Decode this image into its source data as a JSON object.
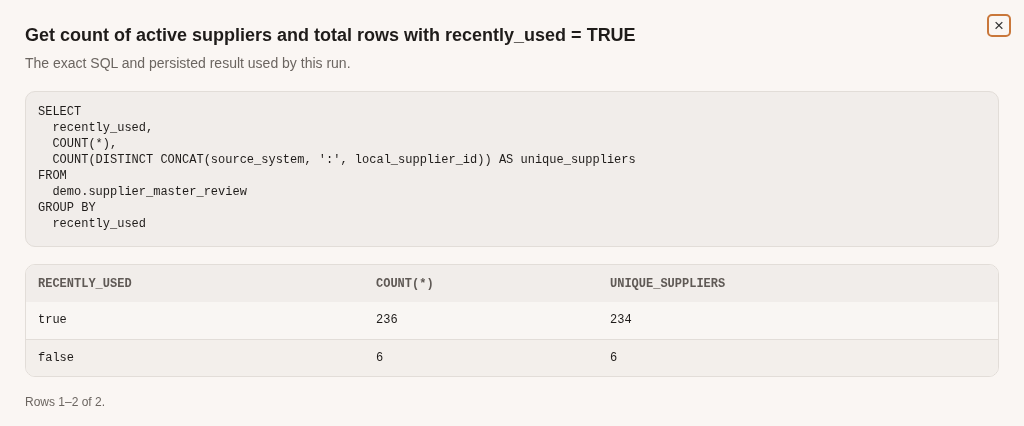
{
  "dialog": {
    "title": "Get count of active suppliers and total rows with recently_used = TRUE",
    "subtitle": "The exact SQL and persisted result used by this run.",
    "close_label": "×"
  },
  "sql": "SELECT\n  recently_used,\n  COUNT(*),\n  COUNT(DISTINCT CONCAT(source_system, ':', local_supplier_id)) AS unique_suppliers\nFROM\n  demo.supplier_master_review\nGROUP BY\n  recently_used",
  "table": {
    "columns": [
      "RECENTLY_USED",
      "COUNT(*)",
      "UNIQUE_SUPPLIERS"
    ],
    "rows": [
      [
        "true",
        "236",
        "234"
      ],
      [
        "false",
        "6",
        "6"
      ]
    ]
  },
  "footer": "Rows 1–2 of 2."
}
